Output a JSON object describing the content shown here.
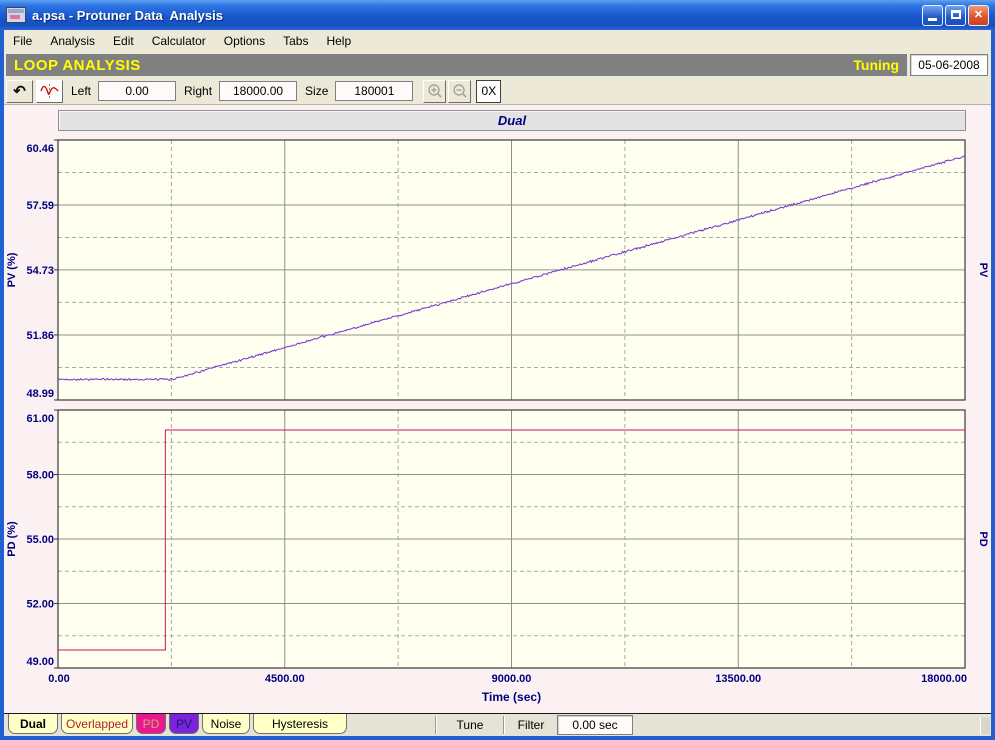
{
  "window": {
    "title": "a.psa - Protuner Data  Analysis",
    "minimize": "minimize",
    "maximize": "maximize",
    "close": "close"
  },
  "menu": {
    "items": [
      "File",
      "Analysis",
      "Edit",
      "Calculator",
      "Options",
      "Tabs",
      "Help"
    ]
  },
  "header": {
    "title": "LOOP ANALYSIS",
    "mode": "Tuning",
    "date": "05-06-2008"
  },
  "toolbar": {
    "undo_glyph": "↶",
    "left_label": "Left",
    "left_value": "0.00",
    "right_label": "Right",
    "right_value": "18000.00",
    "size_label": "Size",
    "size_value": "180001",
    "reset_zoom_label": "0X"
  },
  "colors": {
    "window_blue": "#2160D3",
    "header_gray": "#808080",
    "loop_yellow": "#FFFF00",
    "content_bg": "#FBF0F2",
    "plot_bg": "#FFFFF0",
    "axis_text": "#000080",
    "grid_solid": "#909090",
    "grid_dashed": "#A8A8A8",
    "pv_line": "#7A33CC",
    "pd_line": "#CC1166"
  },
  "chart_data": [
    {
      "type": "line",
      "title": "Dual",
      "ylabel": "PV (%)",
      "right_label": "PV",
      "xlim": [
        0,
        18000
      ],
      "ylim": [
        48.99,
        60.46
      ],
      "yticks": [
        60.46,
        57.59,
        54.73,
        51.86,
        48.99
      ],
      "ytick_labels": [
        "60.46",
        "57.59",
        "54.73",
        "51.86",
        "48.99"
      ],
      "xticks": [
        0,
        4500,
        9000,
        13500,
        18000
      ],
      "grid": "solid-at-ticks-dashed-at-midpoints",
      "series": [
        {
          "name": "PV",
          "color": "#7A33CC",
          "noise": 0.055,
          "points": [
            [
              0,
              49.9
            ],
            [
              2260,
              49.9
            ],
            [
              18000,
              59.75
            ]
          ]
        }
      ]
    },
    {
      "type": "line",
      "ylabel": "PD (%)",
      "right_label": "PD",
      "xlim": [
        0,
        18000
      ],
      "ylim": [
        49.0,
        61.0
      ],
      "yticks": [
        61.0,
        58.0,
        55.0,
        52.0,
        49.0
      ],
      "ytick_labels": [
        "61.00",
        "58.00",
        "55.00",
        "52.00",
        "49.00"
      ],
      "xticks": [
        0,
        4500,
        9000,
        13500,
        18000
      ],
      "xtick_labels": [
        "0.00",
        "4500.00",
        "9000.00",
        "13500.00",
        "18000.00"
      ],
      "xlabel": "Time (sec)",
      "grid": "solid-at-ticks-dashed-at-midpoints",
      "series": [
        {
          "name": "PD",
          "color": "#CC1166",
          "noise": 0,
          "points": [
            [
              0,
              49.84
            ],
            [
              2130,
              49.84
            ],
            [
              2130,
              60.07
            ],
            [
              18000,
              60.07
            ]
          ]
        }
      ]
    }
  ],
  "tabs": [
    {
      "label": "Dual",
      "bg": "#FFFFC8",
      "fg": "#000000",
      "active": true
    },
    {
      "label": "Overlapped",
      "bg": "#FFFFC8",
      "fg": "#B22222",
      "active": false
    },
    {
      "label": "PD",
      "bg": "#EE1690",
      "fg": "#BDB76B",
      "active": false
    },
    {
      "label": "PV",
      "bg": "#7B22DD",
      "fg": "#191970",
      "active": false
    },
    {
      "label": "Noise",
      "bg": "#FFFFC8",
      "fg": "#000000",
      "active": false
    },
    {
      "label": "Hysteresis",
      "bg": "#FFFFC8",
      "fg": "#000000",
      "active": false
    }
  ],
  "bottom_bar": {
    "tune_label": "Tune",
    "filter_label": "Filter",
    "time_value": "0.00 sec"
  }
}
